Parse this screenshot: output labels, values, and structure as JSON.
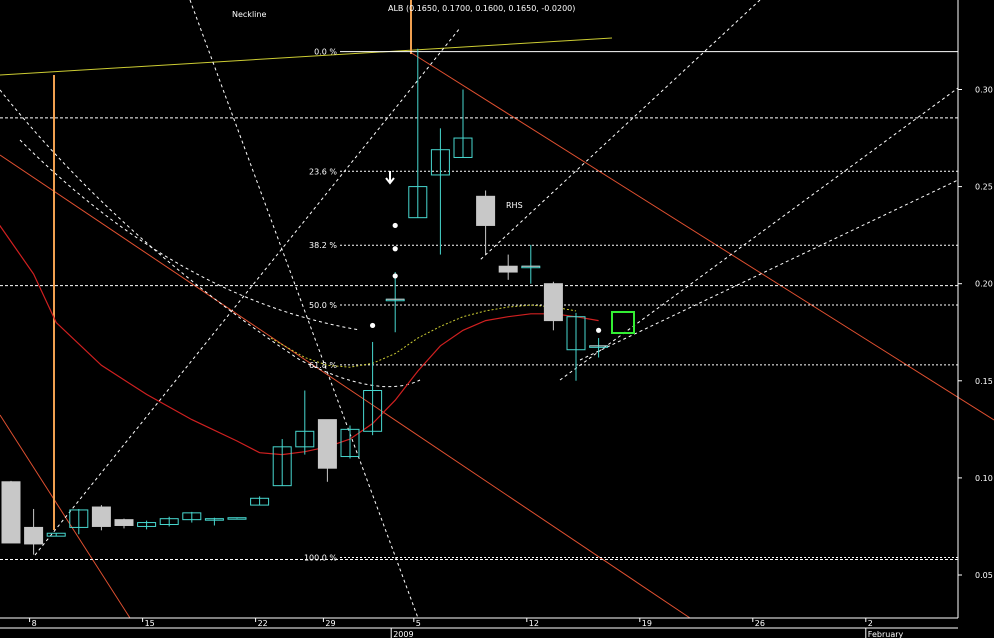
{
  "chart_data": {
    "type": "candlestick",
    "title": "ALB (0.1650, 0.1700, 0.1600, 0.1650, -0.0200)",
    "annotations": {
      "neckline": "Neckline",
      "rhs": "RHS"
    },
    "ylim": [
      0.04,
      0.34
    ],
    "y_ticks": [
      "0.30",
      "0.25",
      "0.20",
      "0.15",
      "0.10",
      "0.05"
    ],
    "x_ticks": [
      {
        "label": "8",
        "i": 1
      },
      {
        "label": "15",
        "i": 6
      },
      {
        "label": "22",
        "i": 11
      },
      {
        "label": "29",
        "i": 14
      },
      {
        "label": "5",
        "i": 18
      },
      {
        "label": "12",
        "i": 23
      },
      {
        "label": "19",
        "i": 28
      },
      {
        "label": "26",
        "i": 33
      },
      {
        "label": "2",
        "i": 38
      }
    ],
    "x_secondary": [
      {
        "label": "2009",
        "i": 17
      },
      {
        "label": "February",
        "i": 38
      }
    ],
    "fib_levels": [
      {
        "label": "0.0 %",
        "y": 0.3195
      },
      {
        "label": "23.6 %",
        "y": 0.2579
      },
      {
        "label": "38.2 %",
        "y": 0.2198
      },
      {
        "label": "50.0 %",
        "y": 0.189
      },
      {
        "label": "61.8 %",
        "y": 0.1582
      },
      {
        "label": "100.0 %",
        "y": 0.059
      }
    ],
    "h_lines": [
      0.2854,
      0.199,
      0.058
    ],
    "candles": [
      {
        "i": 0,
        "o": 0.098,
        "h": 0.0985,
        "l": 0.0665,
        "c": 0.0665
      },
      {
        "i": 1,
        "o": 0.0745,
        "h": 0.084,
        "l": 0.0605,
        "c": 0.066
      },
      {
        "i": 2,
        "o": 0.07,
        "h": 0.0715,
        "l": 0.07,
        "c": 0.0715
      },
      {
        "i": 3,
        "o": 0.0745,
        "h": 0.084,
        "l": 0.071,
        "c": 0.0835
      },
      {
        "i": 4,
        "o": 0.085,
        "h": 0.086,
        "l": 0.073,
        "c": 0.075
      },
      {
        "i": 5,
        "o": 0.0785,
        "h": 0.079,
        "l": 0.074,
        "c": 0.0755
      },
      {
        "i": 6,
        "o": 0.075,
        "h": 0.078,
        "l": 0.0735,
        "c": 0.077
      },
      {
        "i": 7,
        "o": 0.076,
        "h": 0.08,
        "l": 0.075,
        "c": 0.079
      },
      {
        "i": 8,
        "o": 0.0785,
        "h": 0.0825,
        "l": 0.077,
        "c": 0.082
      },
      {
        "i": 9,
        "o": 0.079,
        "h": 0.0795,
        "l": 0.0755,
        "c": 0.079
      },
      {
        "i": 10,
        "o": 0.079,
        "h": 0.0795,
        "l": 0.079,
        "c": 0.0795
      },
      {
        "i": 11,
        "o": 0.086,
        "h": 0.0905,
        "l": 0.086,
        "c": 0.0895
      },
      {
        "i": 12,
        "o": 0.096,
        "h": 0.12,
        "l": 0.096,
        "c": 0.116
      },
      {
        "i": 13,
        "o": 0.116,
        "h": 0.145,
        "l": 0.112,
        "c": 0.124
      },
      {
        "i": 14,
        "o": 0.13,
        "h": 0.13,
        "l": 0.098,
        "c": 0.105
      },
      {
        "i": 15,
        "o": 0.111,
        "h": 0.127,
        "l": 0.11,
        "c": 0.125
      },
      {
        "i": 16,
        "o": 0.124,
        "h": 0.17,
        "l": 0.122,
        "c": 0.145
      },
      {
        "i": 17,
        "o": 0.192,
        "h": 0.206,
        "l": 0.175,
        "c": 0.192
      },
      {
        "i": 18,
        "o": 0.234,
        "h": 0.321,
        "l": 0.234,
        "c": 0.25
      },
      {
        "i": 19,
        "o": 0.256,
        "h": 0.28,
        "l": 0.215,
        "c": 0.269
      },
      {
        "i": 20,
        "o": 0.265,
        "h": 0.3,
        "l": 0.265,
        "c": 0.275
      },
      {
        "i": 21,
        "o": 0.245,
        "h": 0.248,
        "l": 0.215,
        "c": 0.23
      },
      {
        "i": 22,
        "o": 0.209,
        "h": 0.215,
        "l": 0.202,
        "c": 0.206
      },
      {
        "i": 23,
        "o": 0.209,
        "h": 0.22,
        "l": 0.2,
        "c": 0.209
      },
      {
        "i": 24,
        "o": 0.2,
        "h": 0.201,
        "l": 0.176,
        "c": 0.181
      },
      {
        "i": 25,
        "o": 0.166,
        "h": 0.185,
        "l": 0.15,
        "c": 0.183
      },
      {
        "i": 26,
        "o": 0.168,
        "h": 0.172,
        "l": 0.162,
        "c": 0.168
      }
    ],
    "dots": [
      {
        "i": 16,
        "y": 0.1785
      },
      {
        "i": 17,
        "y": 0.23
      },
      {
        "i": 17,
        "y": 0.218
      },
      {
        "i": 17,
        "y": 0.204
      },
      {
        "i": 26,
        "y": 0.176
      }
    ],
    "ma_red": [
      [
        -0.5,
        0.23
      ],
      [
        1,
        0.205
      ],
      [
        2,
        0.18
      ],
      [
        4,
        0.158
      ],
      [
        6,
        0.143
      ],
      [
        8,
        0.13
      ],
      [
        10,
        0.119
      ],
      [
        11,
        0.113
      ],
      [
        12,
        0.112
      ],
      [
        13,
        0.1135
      ],
      [
        14,
        0.116
      ],
      [
        15,
        0.12
      ],
      [
        16,
        0.128
      ],
      [
        17,
        0.14
      ],
      [
        18,
        0.155
      ],
      [
        19,
        0.168
      ],
      [
        20,
        0.176
      ],
      [
        21,
        0.181
      ],
      [
        22,
        0.183
      ],
      [
        23,
        0.1845
      ],
      [
        24,
        0.1845
      ],
      [
        25,
        0.183
      ],
      [
        26,
        0.181
      ]
    ],
    "ma_yellow": [
      [
        11.5,
        0.172
      ],
      [
        13,
        0.162
      ],
      [
        14,
        0.158
      ],
      [
        15,
        0.157
      ],
      [
        16,
        0.159
      ],
      [
        17,
        0.164
      ],
      [
        18,
        0.172
      ],
      [
        19,
        0.178
      ],
      [
        20,
        0.183
      ],
      [
        21,
        0.186
      ],
      [
        22,
        0.188
      ],
      [
        23,
        0.189
      ],
      [
        24,
        0.188
      ],
      [
        25,
        0.186
      ]
    ],
    "accent": {
      "up": "#48d8d0",
      "down": "#c8c8c8",
      "ma_red": "#d02020",
      "fib_line": "#ffffff",
      "trendline": "#cccc33",
      "vertical_marker": "#f0a050",
      "channel": "#e05030",
      "target_box": "#33ee33"
    }
  }
}
